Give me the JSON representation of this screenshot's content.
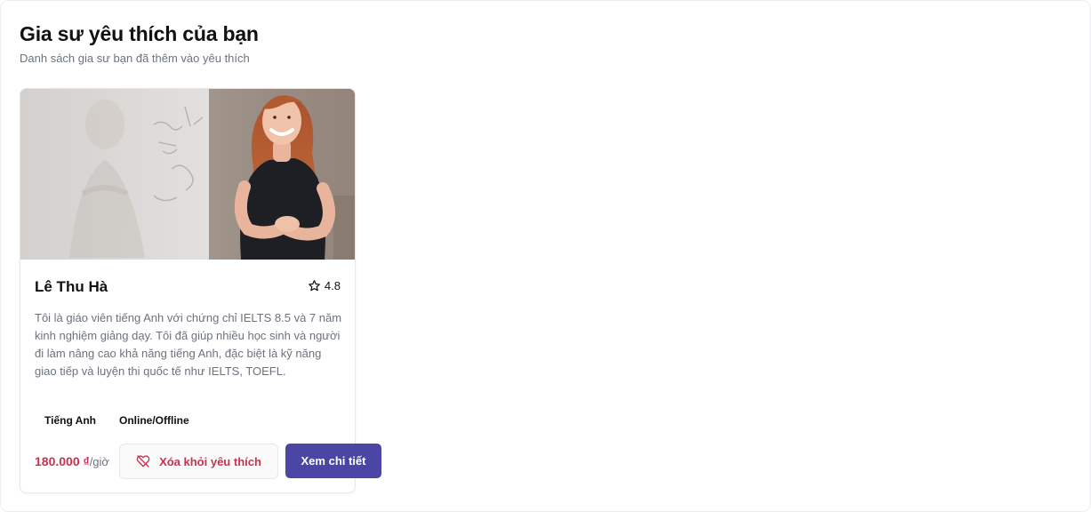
{
  "header": {
    "title": "Gia sư yêu thích của bạn",
    "subtitle": "Danh sách gia sư bạn đã thêm vào yêu thích"
  },
  "tutors": [
    {
      "name": "Lê Thu Hà",
      "rating": "4.8",
      "bio": "Tôi là giáo viên tiếng Anh với chứng chỉ IELTS 8.5 và 7 năm kinh nghiệm giảng dạy. Tôi đã giúp nhiều học sinh và người đi làm nâng cao khả năng tiếng Anh, đặc biệt là kỹ năng giao tiếp và luyện thi quốc tế như IELTS, TOEFL.",
      "tags": [
        "Tiếng Anh",
        "Online/Offline"
      ],
      "price": "180.000 ₫",
      "price_unit": "/giờ",
      "remove_label": "Xóa khỏi yêu thích",
      "detail_label": "Xem chi tiết"
    }
  ],
  "colors": {
    "accent": "#4b46a6",
    "price": "#c8324f",
    "muted": "#6b7280"
  },
  "icons": {
    "rating": "star-icon",
    "remove": "heart-off-icon"
  }
}
